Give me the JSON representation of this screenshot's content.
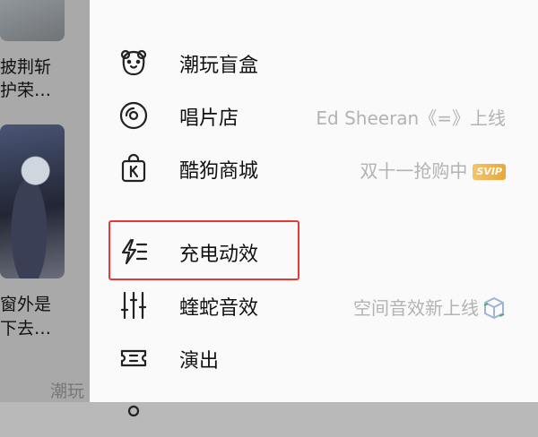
{
  "background": {
    "snippets": [
      "披荆斩",
      "护荣…",
      "窗外是",
      "下去…",
      "潮玩"
    ]
  },
  "menu": {
    "items": [
      {
        "label": "潮玩盲盒",
        "icon": "bear-face-icon",
        "desc": ""
      },
      {
        "label": "唱片店",
        "icon": "vinyl-record-icon",
        "desc": "Ed Sheeran《=》上线"
      },
      {
        "label": "酷狗商城",
        "icon": "shopping-bag-k-icon",
        "desc": "双十一抢购中",
        "badge": "SVIP"
      },
      {
        "label": "充电动效",
        "icon": "lightning-lines-icon",
        "desc": "",
        "highlighted": true
      },
      {
        "label": "蝰蛇音效",
        "icon": "equalizer-sliders-icon",
        "desc": "空间音效新上线",
        "desc_icon": "cube-icon"
      },
      {
        "label": "演出",
        "icon": "ticket-icon",
        "desc": ""
      },
      {
        "label": "",
        "icon": "partial-item-icon",
        "desc": ""
      }
    ]
  },
  "colors": {
    "highlight": "#e53935",
    "svip_gold": "#e9a63a",
    "muted_text": "#b3b3b3"
  }
}
